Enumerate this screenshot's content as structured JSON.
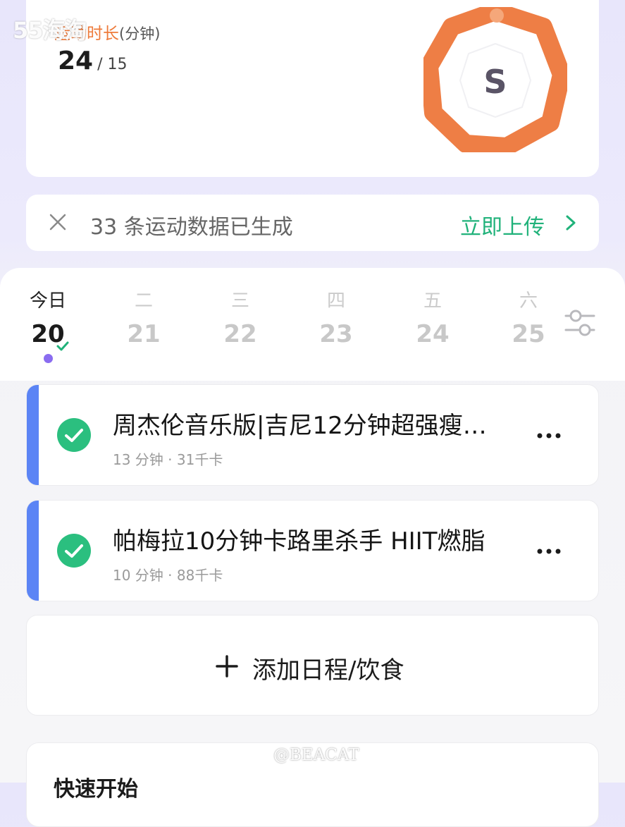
{
  "stats": {
    "label": "运动时长",
    "unit": "(分钟)",
    "value": "24",
    "separator": "/ 15",
    "badge_letter": "S",
    "ring_color": "#ee7e45"
  },
  "upload_banner": {
    "text": "33 条运动数据已生成",
    "action": "立即上传"
  },
  "calendar": {
    "days": [
      {
        "weekday": "今日",
        "date": "20"
      },
      {
        "weekday": "二",
        "date": "21"
      },
      {
        "weekday": "三",
        "date": "22"
      },
      {
        "weekday": "四",
        "date": "23"
      },
      {
        "weekday": "五",
        "date": "24"
      },
      {
        "weekday": "六",
        "date": "25"
      }
    ]
  },
  "tasks": [
    {
      "title": "周杰伦音乐版|吉尼12分钟超强瘦…",
      "meta": "13 分钟 · 31千卡"
    },
    {
      "title": "帕梅拉10分钟卡路里杀手 HIIT燃脂",
      "meta": "10 分钟 · 88千卡"
    }
  ],
  "add_button": {
    "label": "添加日程/饮食"
  },
  "bottom_card": {
    "title": "快速开始"
  },
  "watermarks": {
    "top": "55海淘",
    "bottom": "@BEACAT"
  },
  "colors": {
    "accent_green": "#20b27a",
    "accent_orange": "#ee7a3a",
    "task_bar": "#5b84f5",
    "today_dot": "#8a6cf0"
  }
}
